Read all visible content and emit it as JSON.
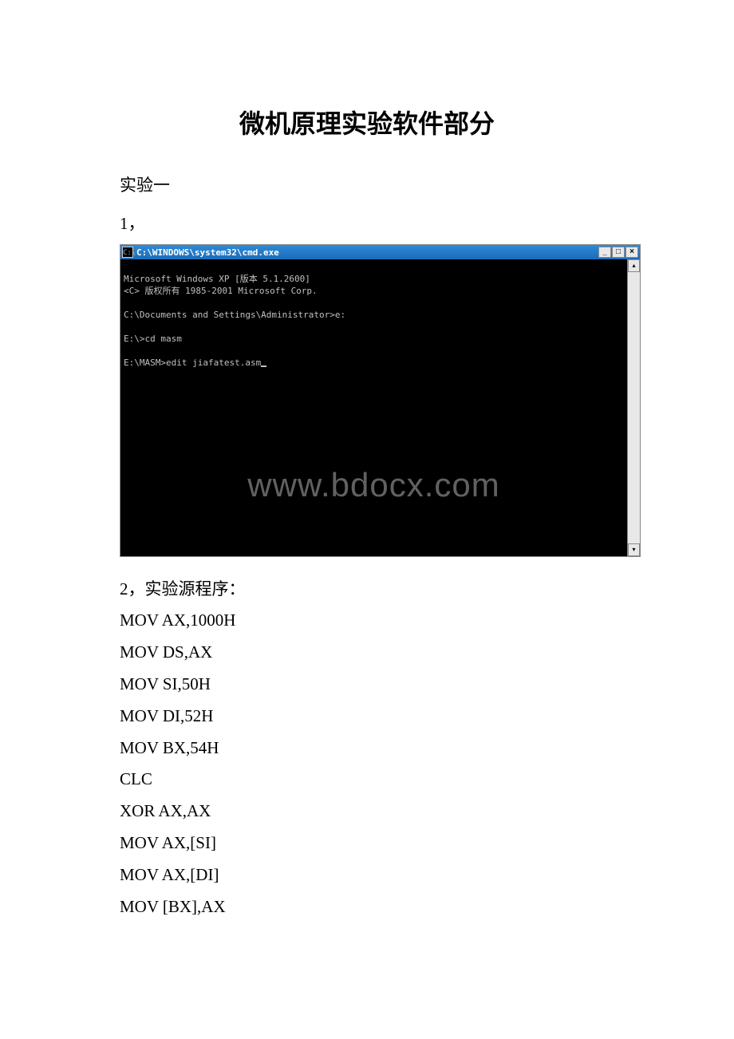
{
  "doc": {
    "title": "微机原理实验软件部分",
    "section": "实验一",
    "item1": "1，",
    "item2_label": "2，实验源程序：",
    "code": [
      "MOV AX,1000H",
      "MOV DS,AX",
      "MOV SI,50H",
      "MOV DI,52H",
      "MOV BX,54H",
      "CLC",
      "XOR AX,AX",
      "MOV AX,[SI]",
      "MOV AX,[DI]",
      "MOV [BX],AX"
    ]
  },
  "cmd": {
    "icon_text": "C:\\",
    "title": "C:\\WINDOWS\\system32\\cmd.exe",
    "btn_min": "_",
    "btn_max": "□",
    "btn_close": "×",
    "scroll_up": "▴",
    "scroll_down": "▾",
    "lines": [
      "Microsoft Windows XP [版本 5.1.2600]",
      "<C> 版权所有 1985-2001 Microsoft Corp.",
      "",
      "C:\\Documents and Settings\\Administrator>e:",
      "",
      "E:\\>cd masm",
      "",
      "E:\\MASM>edit jiafatest.asm"
    ],
    "watermark": "www.bdocx.com"
  }
}
